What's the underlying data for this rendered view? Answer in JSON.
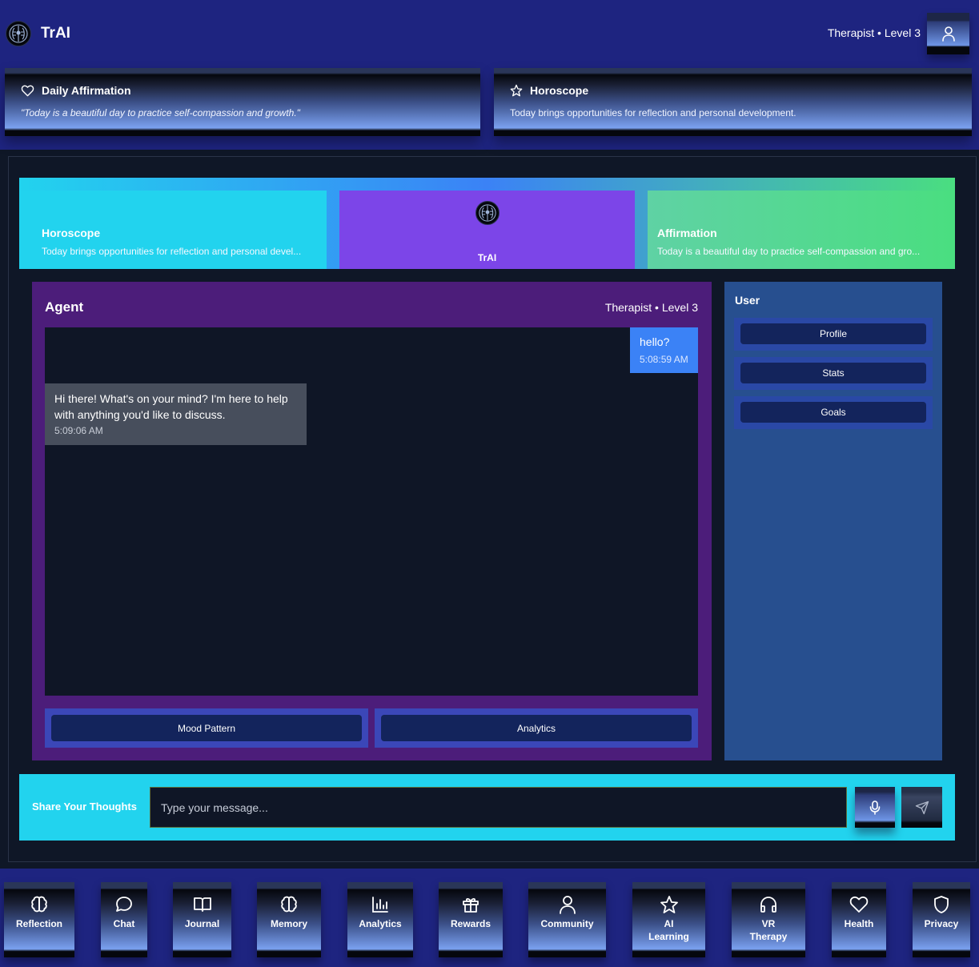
{
  "header": {
    "app_name": "TrAI",
    "role_level": "Therapist • Level 3"
  },
  "top_cards": {
    "affirmation": {
      "title": "Daily Affirmation",
      "text": "\"Today is a beautiful day to practice self-compassion and growth.\""
    },
    "horoscope": {
      "title": "Horoscope",
      "text": "Today brings opportunities for reflection and personal development."
    }
  },
  "banner": {
    "horoscope_title": "Horoscope",
    "horoscope_text": "Today brings opportunities for reflection and personal devel...",
    "center_name": "TrAI",
    "affirmation_title": "Affirmation",
    "affirmation_text": "Today is a beautiful day to practice self-compassion and gro..."
  },
  "agent": {
    "title": "Agent",
    "role_level": "Therapist • Level 3",
    "messages": [
      {
        "sender": "user",
        "text": "hello?",
        "time": "5:08:59 AM"
      },
      {
        "sender": "agent",
        "text": "Hi there! What's on your mind? I'm here to help with anything you'd like to discuss.",
        "time": "5:09:06 AM"
      }
    ],
    "actions": [
      "Mood Pattern",
      "Analytics"
    ]
  },
  "user_panel": {
    "title": "User",
    "items": [
      "Profile",
      "Stats",
      "Goals"
    ]
  },
  "share": {
    "label": "Share Your Thoughts",
    "placeholder": "Type your message..."
  },
  "bottom_nav": [
    {
      "label": "Reflection",
      "icon": "brain-icon"
    },
    {
      "label": "Chat",
      "icon": "chat-bubble-icon"
    },
    {
      "label": "Journal",
      "icon": "book-icon"
    },
    {
      "label": "Memory",
      "icon": "brain-icon"
    },
    {
      "label": "Analytics",
      "icon": "bar-chart-icon"
    },
    {
      "label": "Rewards",
      "icon": "gift-icon"
    },
    {
      "label": "Community",
      "icon": "user-icon"
    },
    {
      "label": "AI\nLearning",
      "icon": "star-icon"
    },
    {
      "label": "VR\nTherapy",
      "icon": "headphones-icon"
    },
    {
      "label": "Health",
      "icon": "heart-icon"
    },
    {
      "label": "Privacy",
      "icon": "shield-icon"
    }
  ],
  "colors": {
    "header_bg": "#1e2480",
    "page_bg": "#0f1727",
    "agent_bg": "#4c1d7a",
    "user_panel_bg": "#274f8f",
    "cyan": "#22d3ee",
    "purple": "#7c45e8",
    "green": "#4ade80",
    "user_bubble": "#3b82f6",
    "agent_bubble": "#474e5c"
  }
}
